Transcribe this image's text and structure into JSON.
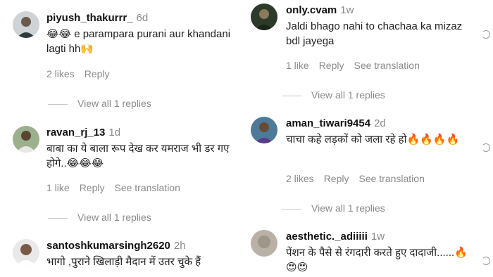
{
  "left": [
    {
      "user": "piyush_thakurrr_",
      "time": "6d",
      "text": "😂😂 e parampara purani aur khandani lagti hh🙌",
      "likes": "2 likes",
      "reply": "Reply",
      "see_translation": "",
      "view_replies": "View all 1 replies"
    },
    {
      "user": "ravan_rj_13",
      "time": "1d",
      "text": "बाबा का ये बाला रूप देख कर यमराज भी डर गए होगे..😂😂😂",
      "likes": "1 like",
      "reply": "Reply",
      "see_translation": "See translation",
      "view_replies": "View all 1 replies"
    },
    {
      "user": "santoshkumarsingh2620",
      "time": "2h",
      "text": "भागो ,पुराने खिलाड़ी मैदान में उतर चुके हैं"
    }
  ],
  "right": [
    {
      "user": "only.cvam",
      "time": "1w",
      "text": "Jaldi bhago nahi to chachaa ka mizaz bdl jayega",
      "likes": "1 like",
      "reply": "Reply",
      "see_translation": "See translation",
      "view_replies": "View all 1 replies"
    },
    {
      "user": "aman_tiwari9454",
      "time": "2d",
      "text": "चाचा कहे लड़कों को जला रहे हो🔥🔥🔥🔥",
      "likes": "2 likes",
      "reply": "Reply",
      "see_translation": "See translation",
      "view_replies": "View all 1 replies"
    },
    {
      "user": "aesthetic._adiiiii",
      "time": "1w",
      "text": "पेंशन के पैसे से रंगदारी करते हुए दादाजी......🔥😍😍"
    }
  ],
  "icons": {
    "like": "heart-icon"
  },
  "colors": {
    "secondary_text": "#8a8a8a",
    "divider": "#c7c7c7"
  }
}
